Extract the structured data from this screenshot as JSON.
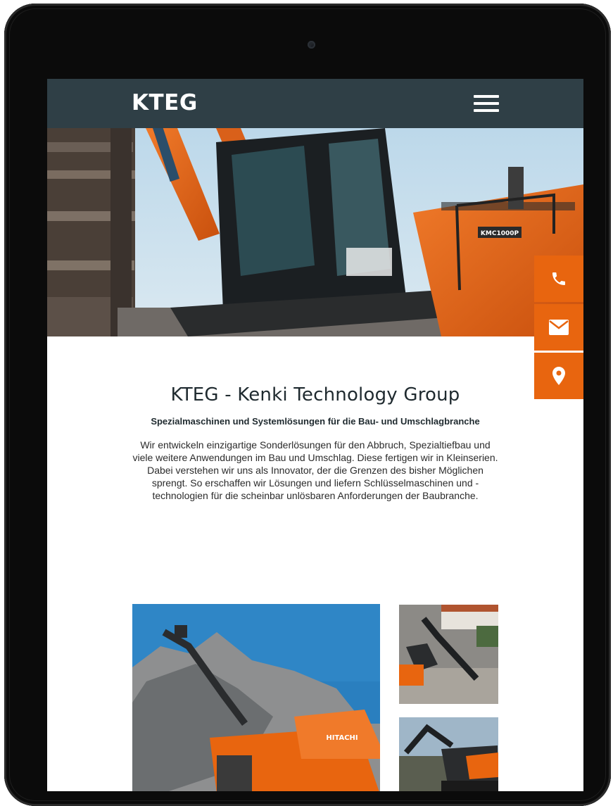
{
  "header": {
    "logo": "KTEG",
    "menu_icon": "hamburger-menu-icon"
  },
  "side_actions": [
    {
      "icon": "phone-icon"
    },
    {
      "icon": "mail-icon"
    },
    {
      "icon": "location-pin-icon"
    }
  ],
  "hero": {
    "machine_badge": "KMC1000P"
  },
  "main": {
    "title": "KTEG - Kenki Technology Group",
    "subtitle": "Spezialmaschinen und Systemlösungen für die Bau- und Umschlagbranche",
    "body": "Wir entwickeln einzigartige Sonderlösungen für den Abbruch, Spezialtiefbau und viele weitere Anwendungen im Bau und Umschlag. Diese fertigen wir in Kleinserien. Dabei verstehen wir uns als Innovator, der die Grenzen des bisher Möglichen sprengt. So erschaffen wir Lösungen und liefern Schlüsselmaschinen und -technologien für die scheinbar unlösbaren Anforderungen der Baubranche."
  },
  "gallery": {
    "main_badge": "HITACHI"
  },
  "colors": {
    "header_bg": "#2f3f46",
    "accent": "#e8650f",
    "text": "#1f2a2f"
  }
}
